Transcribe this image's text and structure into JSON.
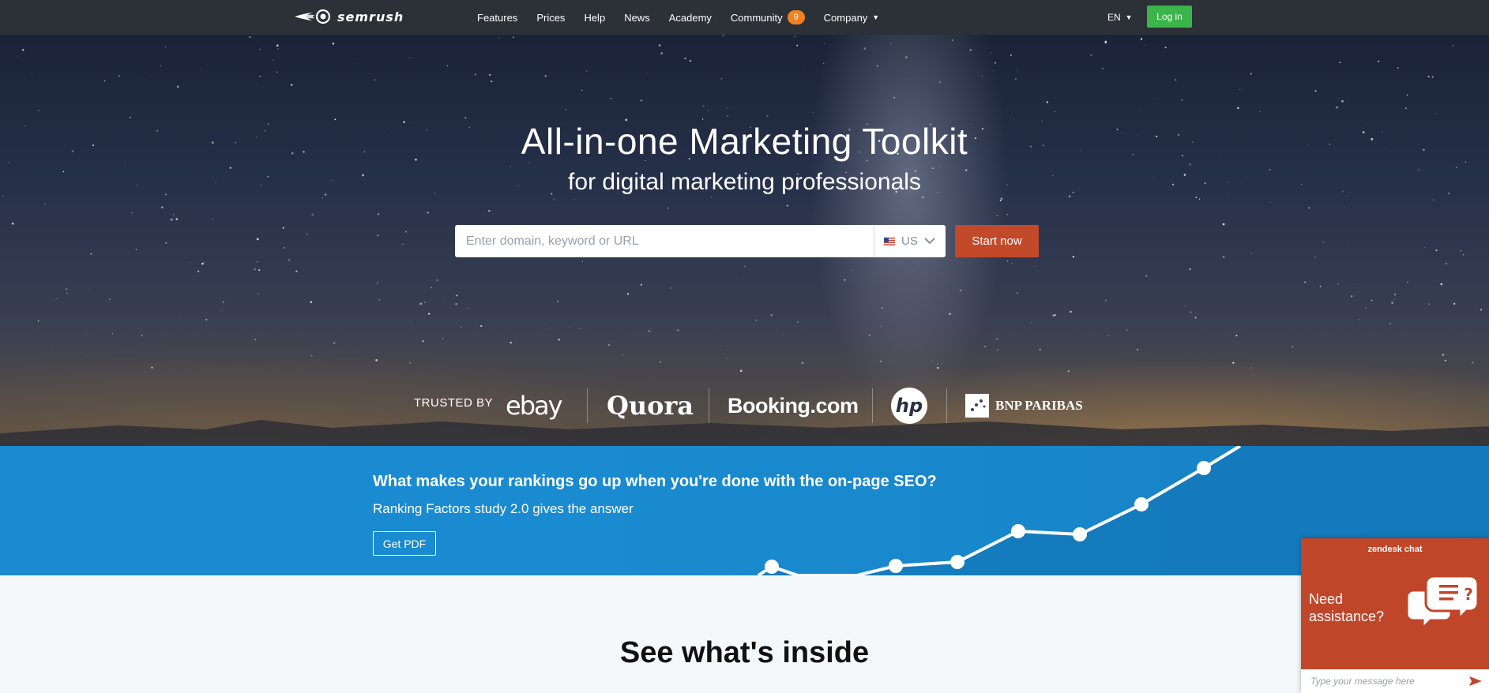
{
  "header": {
    "logo_text": "semrush",
    "nav": [
      {
        "label": "Features"
      },
      {
        "label": "Prices"
      },
      {
        "label": "Help"
      },
      {
        "label": "News"
      },
      {
        "label": "Academy"
      },
      {
        "label": "Community",
        "badge": "9"
      },
      {
        "label": "Company",
        "has_dropdown": true
      }
    ],
    "language": "EN",
    "login_label": "Log in"
  },
  "hero": {
    "title": "All-in-one Marketing Toolkit",
    "subtitle": "for digital marketing professionals",
    "search": {
      "placeholder": "Enter domain, keyword or URL",
      "value": "",
      "database": "US"
    },
    "start_label": "Start now",
    "trusted_label": "TRUSTED BY",
    "brands": [
      "ebay",
      "Quora",
      "Booking.com",
      "hp",
      "BNP PARIBAS"
    ]
  },
  "promo": {
    "title": "What makes your rankings go up when you're done with the on-page SEO?",
    "subtitle": "Ranking Factors study 2.0 gives the answer",
    "button_label": "Get PDF"
  },
  "section": {
    "title": "See what's inside"
  },
  "chat": {
    "brand": "zendesk chat",
    "line1": "Need",
    "line2": "assistance?",
    "input_placeholder": "Type your message here"
  },
  "colors": {
    "topbar": "#2b3136",
    "login_green": "#3bb44a",
    "start_orange": "#c2492a",
    "badge_orange": "#ef8123",
    "promo_blue": "#1a8bd0",
    "chat_red": "#c0462a"
  }
}
